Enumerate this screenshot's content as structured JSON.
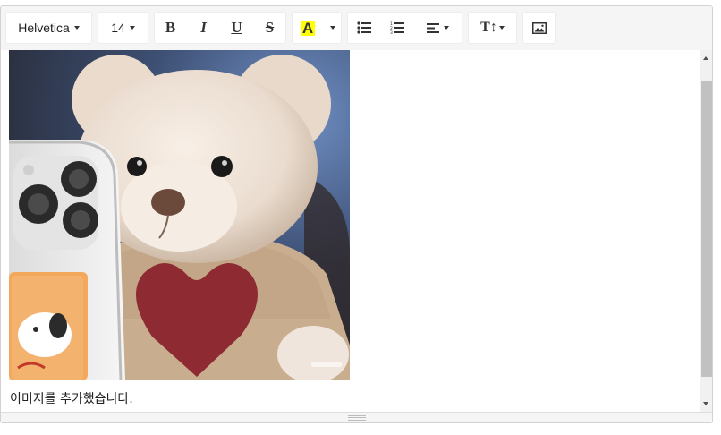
{
  "toolbar": {
    "font_family": "Helvetica",
    "font_size": "14",
    "bold": "B",
    "italic": "I",
    "underline": "U",
    "strikethrough": "S",
    "highlight": "A",
    "highlight_color": "#ffff00",
    "text_height": "T↕"
  },
  "content": {
    "caption": "이미지를 추가했습니다."
  }
}
